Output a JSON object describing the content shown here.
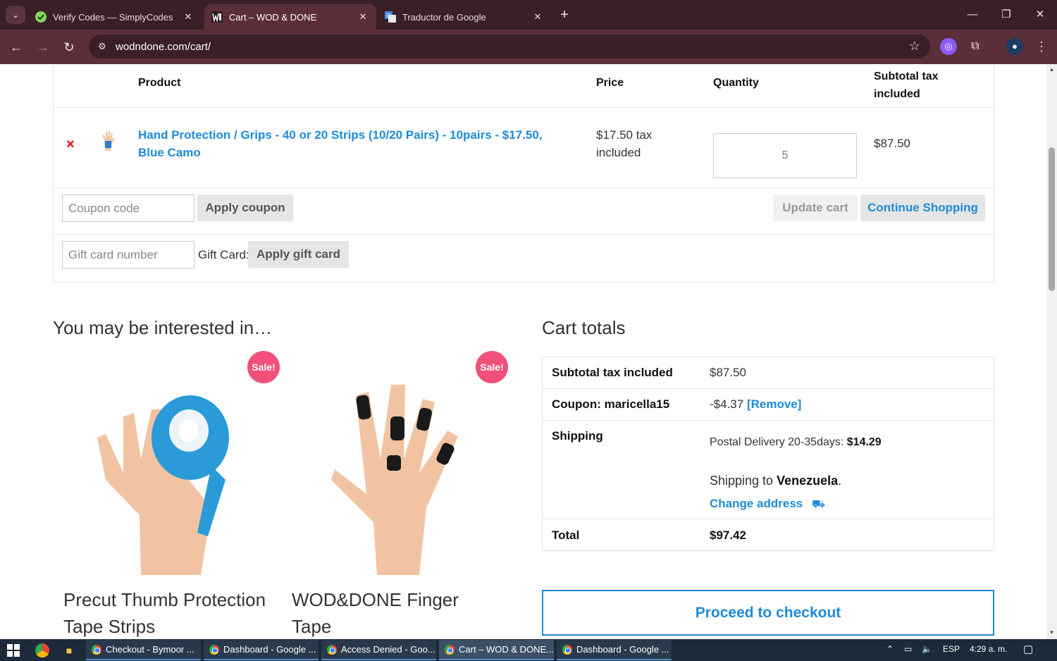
{
  "browser": {
    "tabs": [
      {
        "title": "Verify Codes — SimplyCodes",
        "close": "✕"
      },
      {
        "title": "Cart – WOD & DONE",
        "close": "✕"
      },
      {
        "title": "Traductor de Google",
        "close": "✕"
      }
    ],
    "new_tab": "+",
    "url": "wodndone.com/cart/"
  },
  "cart": {
    "headers": {
      "product": "Product",
      "price": "Price",
      "quantity": "Quantity",
      "subtotal": "Subtotal tax included"
    },
    "items": [
      {
        "remove": "×",
        "name": "Hand Protection / Grips - 40 or 20 Strips (10/20 Pairs) - 10pairs - $17.50, Blue Camo",
        "price": "$17.50 tax included",
        "quantity": "5",
        "subtotal": "$87.50"
      }
    ],
    "coupon_placeholder": "Coupon code",
    "apply_coupon": "Apply coupon",
    "update_cart": "Update cart",
    "continue_shopping": "Continue Shopping",
    "gift_placeholder": "Gift card number",
    "gift_label": "Gift Card:",
    "apply_gift": "Apply gift card"
  },
  "upsell": {
    "title": "You may be interested in…",
    "products": [
      {
        "badge": "Sale!",
        "name": "Precut Thumb Protection Tape Strips"
      },
      {
        "badge": "Sale!",
        "name": "WOD&DONE Finger Tape"
      }
    ]
  },
  "totals": {
    "title": "Cart totals",
    "subtotal_label": "Subtotal tax included",
    "subtotal_value": "$87.50",
    "coupon_label": "Coupon: maricella15",
    "coupon_value": "-$4.37",
    "coupon_remove": "[Remove]",
    "shipping_label": "Shipping",
    "shipping_method": "Postal Delivery 20-35days:",
    "shipping_cost": "$14.29",
    "shipping_to_prefix": "Shipping to",
    "shipping_country": "Venezuela",
    "change_address": "Change address",
    "total_label": "Total",
    "total_value": "$97.42",
    "checkout": "Proceed to checkout"
  },
  "taskbar": {
    "items": [
      {
        "label": "Checkout - Bymoor ..."
      },
      {
        "label": "Dashboard - Google ..."
      },
      {
        "label": "Access Denied - Goo..."
      },
      {
        "label": "Cart – WOD & DONE..."
      },
      {
        "label": "Dashboard - Google ..."
      }
    ],
    "lang": "ESP",
    "time": "4:29 a. m."
  },
  "colors": {
    "accent": "#1e8ad6",
    "sale": "#f0507a",
    "browser_frame": "#5b2f3a"
  }
}
